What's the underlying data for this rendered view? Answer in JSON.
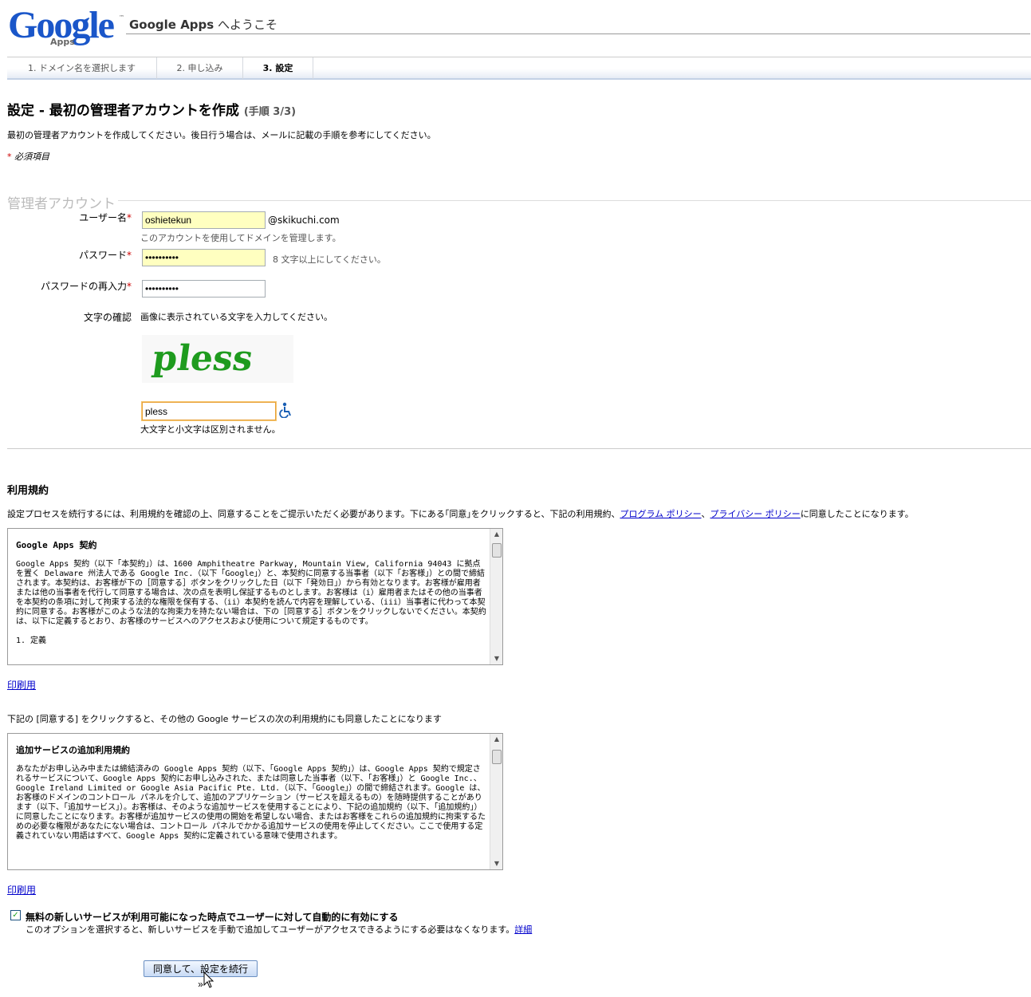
{
  "header": {
    "logo_text": "Google",
    "logo_sub": "Apps",
    "logo_tm": "™",
    "title_brand": "Google Apps",
    "title_rest": " へようこそ"
  },
  "steps": [
    {
      "label": "1. ドメイン名を選択します"
    },
    {
      "label": "2. 申し込み"
    },
    {
      "label": "3. 設定"
    }
  ],
  "page": {
    "title": "設定 - 最初の管理者アカウントを作成",
    "title_step": "(手順 3/3)",
    "intro": "最初の管理者アカウントを作成してください。後日行う場合は、メールに記載の手順を参考にしてください。",
    "required_star": "*",
    "required_note": "必須項目"
  },
  "admin": {
    "legend": "管理者アカウント",
    "username_label": "ユーザー名",
    "username_value": "oshietekun",
    "domain_suffix": "@skikuchi.com",
    "username_hint": "このアカウントを使用してドメインを管理します。",
    "password_label": "パスワード",
    "password_value": "••••••••••",
    "password_hint": "8 文字以上にしてください。",
    "password_confirm_label": "パスワードの再入力",
    "password_confirm_value": "••••••••••",
    "captcha_label": "文字の確認",
    "captcha_instruction": "画像に表示されている文字を入力してください。",
    "captcha_image_text": "pless",
    "captcha_value": "pless",
    "captcha_hint": "大文字と小文字は区別されません。"
  },
  "tos": {
    "heading": "利用規約",
    "lead_before": "設定プロセスを続行するには、利用規約を確認の上、同意することをご提示いただく必要があります。下にある｢同意｣をクリックすると、下記の利用規約、",
    "program_policy_link": "プログラム ポリシー",
    "separator": "、",
    "privacy_policy_link": "プライバシー ポリシー",
    "lead_after": "に同意したことになります。",
    "box1_heading": "Google Apps 契約",
    "box1_body": "Google Apps 契約（以下「本契約」）は、1600 Amphitheatre Parkway, Mountain View, California 94043 に拠点を置く Delaware 州法人である Google Inc.（以下「Google」）と、本契約に同意する当事者（以下「お客様」）との間で締結されます。本契約は、お客様が下の［同意する］ボタンをクリックした日（以下「発効日」）から有効となります。お客様が雇用者または他の当事者を代行して同意する場合は、次の点を表明し保証するものとします。お客様は（i）雇用者またはその他の当事者を本契約の条項に対して拘束する法的な権限を保有する、（ii）本契約を読んで内容を理解している、（iii）当事者に代わって本契約に同意する。お客様がこのような法的な拘束力を持たない場合は、下の［同意する］ボタンをクリックしないでください。本契約は、以下に定義するとおり、お客様のサービスへのアクセスおよび使用について規定するものです。",
    "box1_next": "1. 定義",
    "print_link": "印刷用",
    "more_lead": "下記の [同意する] をクリックすると、その他の Google サービスの次の利用規約にも同意したことになります",
    "box2_heading": "追加サービスの追加利用規約",
    "box2_body": "あなたがお申し込み中または締結済みの Google Apps 契約（以下、「Google Apps 契約」）は、Google Apps 契約で規定されるサービスについて、Google Apps 契約にお申し込みされた、または同意した当事者（以下、「お客様」）と Google Inc.、Google Ireland Limited or Google Asia Pacific Pte. Ltd.（以下、「Google」）の間で締結されます。Google は、お客様のドメインのコントロール パネルを介して、追加のアプリケーション（サービスを超えるもの）を随時提供することがあります（以下、「追加サービス」）。お客様は、そのような追加サービスを使用することにより、下記の追加規約（以下、「追加規約」）に同意したことになります。お客様が追加サービスの使用の開始を希望しない場合、またはお客様をこれらの追加規約に拘束するための必要な権限があなたにない場合は、コントロール パネルでかかる追加サービスの使用を停止してください。ここで使用する定義されていない用語はすべて、Google Apps 契約に定義されている意味で使用されます。",
    "print_link_2": "印刷用"
  },
  "option": {
    "checkbox_mark": "✓",
    "label": "無料の新しいサービスが利用可能になった時点でユーザーに対して自動的に有効にする",
    "desc": "このオプションを選択すると、新しいサービスを手動で追加してユーザーがアクセスできるようにする必要はなくなります。",
    "details_link": "詳細"
  },
  "continue_button": "同意して、設定を続行 »",
  "colors": {
    "link": "#0000cc",
    "required": "#cc0000",
    "highlight_field": "#ffffc0"
  }
}
